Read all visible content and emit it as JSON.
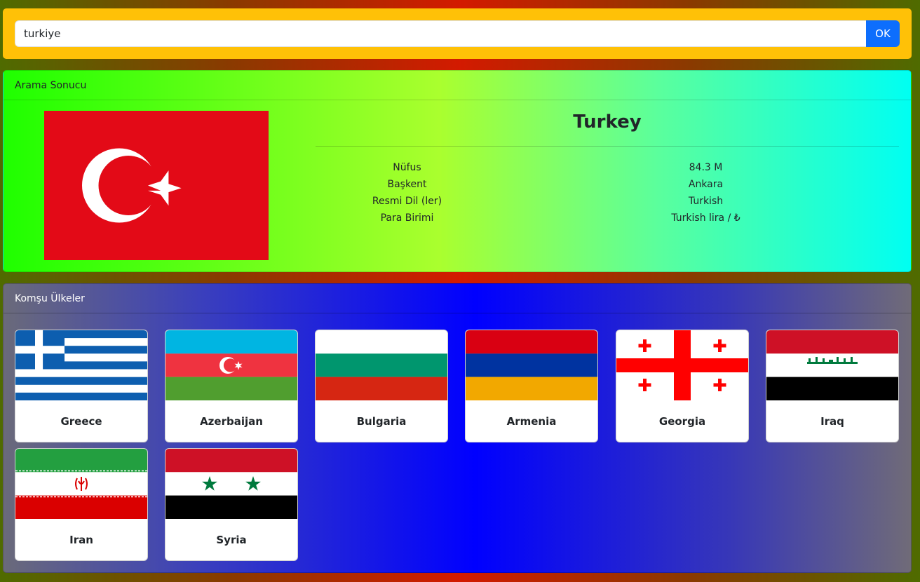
{
  "search": {
    "value": "turkiye",
    "button_label": "OK"
  },
  "result": {
    "header": "Arama Sonucu",
    "country_name": "Turkey",
    "flag_icon": "turkey-flag",
    "info": [
      {
        "label": "Nüfus",
        "value": "84.3 M"
      },
      {
        "label": "Başkent",
        "value": "Ankara"
      },
      {
        "label": "Resmi Dil (ler)",
        "value": "Turkish"
      },
      {
        "label": "Para Birimi",
        "value": "Turkish lira / ₺"
      }
    ]
  },
  "neighbors": {
    "header": "Komşu Ülkeler",
    "items": [
      {
        "name": "Greece",
        "flag_icon": "greece-flag"
      },
      {
        "name": "Azerbaijan",
        "flag_icon": "azerbaijan-flag"
      },
      {
        "name": "Bulgaria",
        "flag_icon": "bulgaria-flag"
      },
      {
        "name": "Armenia",
        "flag_icon": "armenia-flag"
      },
      {
        "name": "Georgia",
        "flag_icon": "georgia-flag"
      },
      {
        "name": "Iraq",
        "flag_icon": "iraq-flag"
      },
      {
        "name": "Iran",
        "flag_icon": "iran-flag"
      },
      {
        "name": "Syria",
        "flag_icon": "syria-flag"
      }
    ]
  },
  "colors": {
    "search_panel": "#ffc107",
    "ok_button": "#0d6efd",
    "turkey_red": "#e30a17"
  }
}
